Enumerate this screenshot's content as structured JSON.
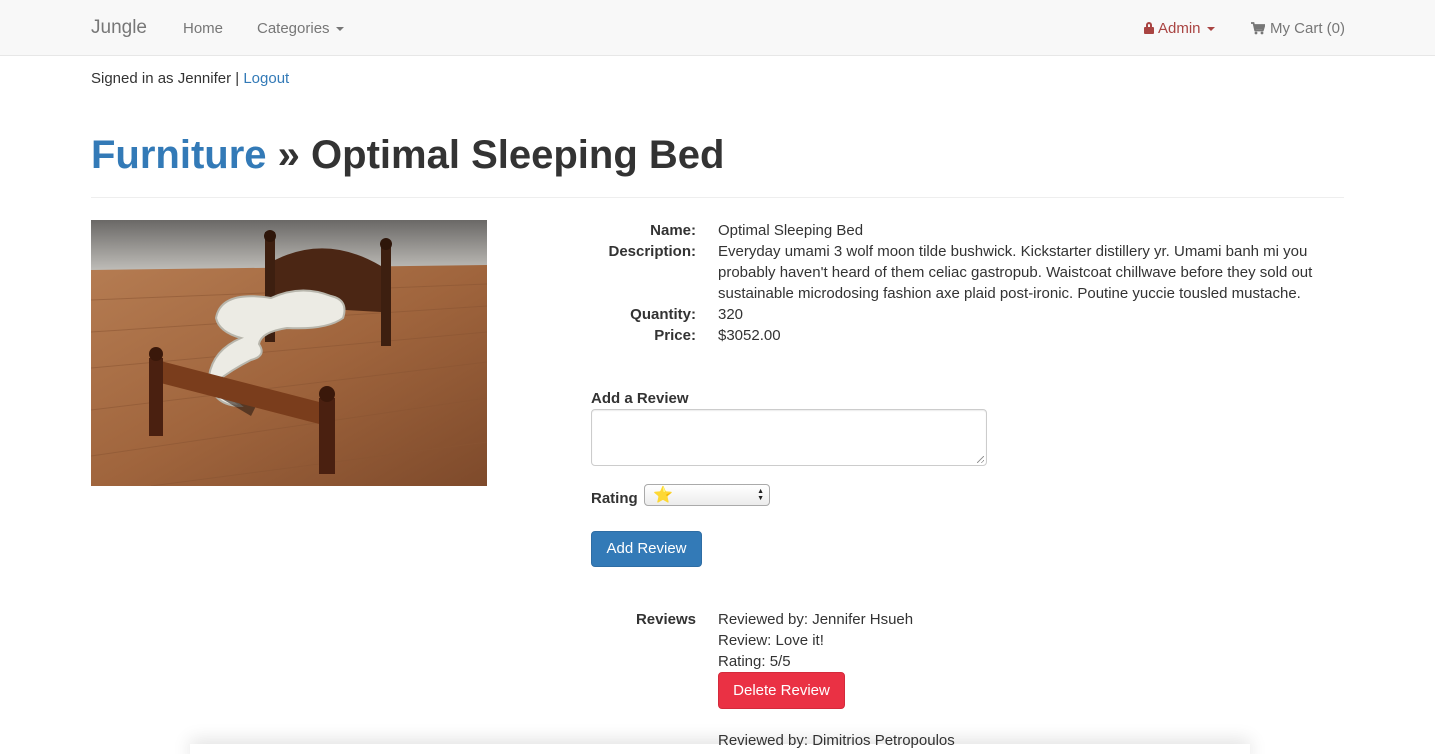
{
  "navbar": {
    "brand": "Jungle",
    "home": "Home",
    "categories": "Categories",
    "admin": "Admin",
    "cart": "My Cart (0)"
  },
  "session": {
    "signed_in_text": "Signed in as Jennifer |",
    "logout": "Logout"
  },
  "page": {
    "category": "Furniture",
    "separator": "»",
    "product_name": "Optimal Sleeping Bed"
  },
  "details": {
    "name_label": "Name:",
    "name_value": "Optimal Sleeping Bed",
    "description_label": "Description:",
    "description_value": "Everyday umami 3 wolf moon tilde bushwick. Kickstarter distillery yr. Umami banh mi you probably haven't heard of them celiac gastropub. Waistcoat chillwave before they sold out sustainable microdosing fashion axe plaid post-ironic. Poutine yuccie tousled mustache.",
    "quantity_label": "Quantity:",
    "quantity_value": "320",
    "price_label": "Price:",
    "price_value": "$3052.00"
  },
  "review_form": {
    "add_review_label": "Add a Review",
    "review_text": "",
    "rating_label": "Rating",
    "rating_selected": "⭐",
    "submit": "Add Review"
  },
  "reviews": {
    "label": "Reviews",
    "items": [
      {
        "reviewer": "Reviewed by: Jennifer Hsueh",
        "review": "Review: Love it!",
        "rating": "Rating: 5/5",
        "delete": "Delete Review"
      },
      {
        "reviewer": "Reviewed by: Dimitrios Petropoulos"
      }
    ]
  },
  "colors": {
    "link": "#337ab7",
    "admin": "#a94442",
    "primary_button": "#337ab7",
    "danger_button": "#ea3144"
  }
}
